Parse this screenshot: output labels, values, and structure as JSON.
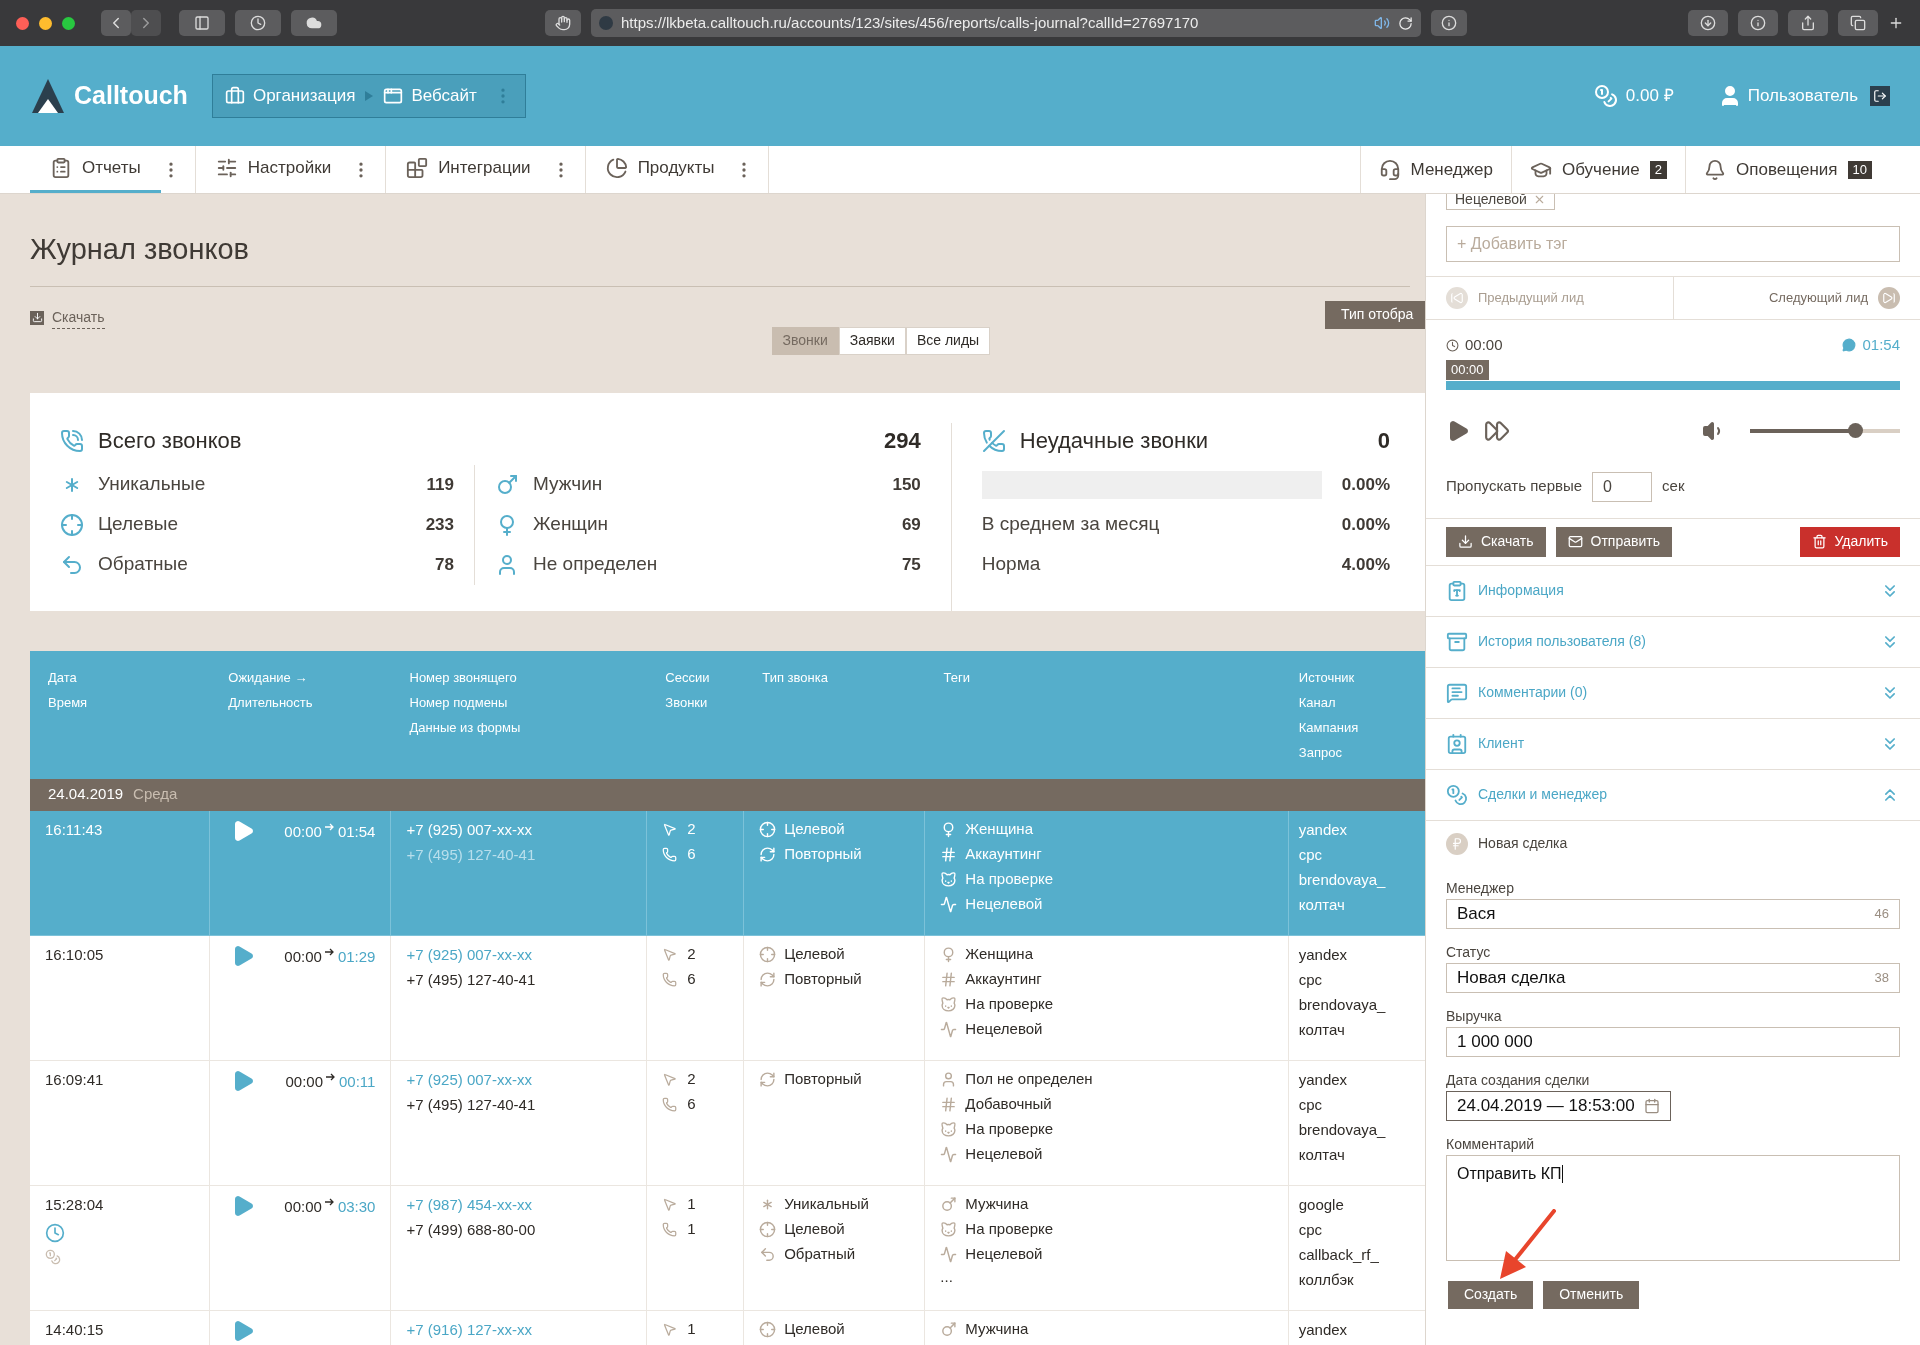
{
  "browser": {
    "url": "https://lkbeta.calltouch.ru/accounts/123/sites/456/reports/calls-journal?callId=27697170"
  },
  "header": {
    "logo": "Calltouch",
    "breadcrumbs": [
      "Организация",
      "Вебсайт"
    ],
    "balance": "0.00 ₽",
    "user": "Пользователь"
  },
  "nav": {
    "left": [
      {
        "kind": "reports",
        "label": "Отчеты",
        "selected": true
      },
      {
        "kind": "settings",
        "label": "Настройки",
        "selected": false
      },
      {
        "kind": "integrations",
        "label": "Интеграции",
        "selected": false
      },
      {
        "kind": "products",
        "label": "Продукты",
        "selected": false
      }
    ],
    "right": [
      {
        "kind": "manager",
        "label": "Менеджер"
      },
      {
        "kind": "learning",
        "label": "Обучение",
        "badge": "2"
      },
      {
        "kind": "alerts",
        "label": "Оповещения",
        "badge": "10"
      }
    ]
  },
  "page": {
    "title": "Журнал звонков",
    "download": "Скачать",
    "display_type": "Тип отобра",
    "tabs": [
      {
        "label": "Звонки",
        "selected": true
      },
      {
        "label": "Заявки",
        "selected": false
      },
      {
        "label": "Все лиды",
        "selected": false
      }
    ]
  },
  "stats": {
    "total": {
      "label": "Всего звонков",
      "value": "294"
    },
    "types": [
      {
        "kind": "unique",
        "label": "Уникальные",
        "value": "119"
      },
      {
        "kind": "target",
        "label": "Целевые",
        "value": "233"
      },
      {
        "kind": "callback",
        "label": "Обратные",
        "value": "78"
      }
    ],
    "genders": [
      {
        "kind": "male",
        "label": "Мужчин",
        "value": "150"
      },
      {
        "kind": "female",
        "label": "Женщин",
        "value": "69"
      },
      {
        "kind": "unknown",
        "label": "Не определен",
        "value": "75"
      }
    ],
    "failed": {
      "label": "Неудачные звонки",
      "value": "0",
      "level": 0,
      "percent": "0.00%",
      "rows": [
        {
          "label": "В среднем за месяц",
          "value": "0.00%"
        },
        {
          "label": "Норма",
          "value": "4.00%"
        }
      ]
    }
  },
  "table": {
    "columns": [
      [
        "Дата",
        "Время"
      ],
      [
        "Ожидание →",
        "Длительность"
      ],
      [
        "Номер звонящего",
        "Номер подмены",
        "Данные из формы"
      ],
      [
        "Сессии",
        "Звонки"
      ],
      [
        "Тип звонка"
      ],
      [
        "Теги"
      ],
      [
        "Источник",
        "Канал",
        "Кампания",
        "Запрос"
      ]
    ],
    "group": {
      "date": "24.04.2019",
      "weekday": "Среда"
    },
    "rows": [
      {
        "selected": true,
        "time": "16:11:43",
        "extra_icons": false,
        "wait": "00:00",
        "duration": "01:54",
        "caller": "+7 (925) 007-xx-xx",
        "substitute": "+7 (495) 127-40-41",
        "sessions": "2",
        "calls": "6",
        "types": [
          {
            "kind": "target",
            "label": "Целевой"
          },
          {
            "kind": "repeat",
            "label": "Повторный"
          }
        ],
        "tags": [
          {
            "kind": "female",
            "label": "Женщина"
          },
          {
            "kind": "hash",
            "label": "Аккаунтинг"
          },
          {
            "kind": "review",
            "label": "На проверке"
          },
          {
            "kind": "nontarget",
            "label": "Нецелевой"
          }
        ],
        "source": [
          "yandex",
          "cpc",
          "brendovaya_",
          "колтач"
        ]
      },
      {
        "selected": false,
        "time": "16:10:05",
        "extra_icons": false,
        "wait": "00:00",
        "duration": "01:29",
        "caller": "+7 (925) 007-xx-xx",
        "substitute": "+7 (495) 127-40-41",
        "sessions": "2",
        "calls": "6",
        "types": [
          {
            "kind": "target",
            "label": "Целевой"
          },
          {
            "kind": "repeat",
            "label": "Повторный"
          }
        ],
        "tags": [
          {
            "kind": "female",
            "label": "Женщина"
          },
          {
            "kind": "hash",
            "label": "Аккаунтинг"
          },
          {
            "kind": "review",
            "label": "На проверке"
          },
          {
            "kind": "nontarget",
            "label": "Нецелевой"
          }
        ],
        "source": [
          "yandex",
          "cpc",
          "brendovaya_",
          "колтач"
        ]
      },
      {
        "selected": false,
        "time": "16:09:41",
        "extra_icons": false,
        "wait": "00:00",
        "duration": "00:11",
        "caller": "+7 (925) 007-xx-xx",
        "substitute": "+7 (495) 127-40-41",
        "sessions": "2",
        "calls": "6",
        "types": [
          {
            "kind": "repeat",
            "label": "Повторный"
          }
        ],
        "tags": [
          {
            "kind": "unknown",
            "label": "Пол не определен"
          },
          {
            "kind": "hash",
            "label": "Добавочный"
          },
          {
            "kind": "review",
            "label": "На проверке"
          },
          {
            "kind": "nontarget",
            "label": "Нецелевой"
          }
        ],
        "source": [
          "yandex",
          "cpc",
          "brendovaya_",
          "колтач"
        ]
      },
      {
        "selected": false,
        "time": "15:28:04",
        "extra_icons": true,
        "wait": "00:00",
        "duration": "03:30",
        "caller": "+7 (987) 454-xx-xx",
        "substitute": "+7 (499) 688-80-00",
        "sessions": "1",
        "calls": "1",
        "types": [
          {
            "kind": "unique",
            "label": "Уникальный"
          },
          {
            "kind": "target",
            "label": "Целевой"
          },
          {
            "kind": "callback",
            "label": "Обратный"
          }
        ],
        "tags": [
          {
            "kind": "male",
            "label": "Мужчина"
          },
          {
            "kind": "review",
            "label": "На проверке"
          },
          {
            "kind": "nontarget",
            "label": "Нецелевой"
          }
        ],
        "more": "...",
        "source": [
          "google",
          "cpc",
          "callback_rf_",
          "коллбэк"
        ]
      },
      {
        "selected": false,
        "time": "14:40:15",
        "extra_icons": false,
        "caller": "+7 (916) 127-xx-xx",
        "sessions": "1",
        "types": [
          {
            "kind": "target",
            "label": "Целевой"
          }
        ],
        "tags": [
          {
            "kind": "male",
            "label": "Мужчина"
          }
        ],
        "source": [
          "yandex"
        ]
      }
    ]
  },
  "panel": {
    "tags": [
      {
        "label": "Нецелевой"
      }
    ],
    "add_tag": {
      "placeholder": "+ Добавить тэг"
    },
    "prev": "Предыдущий лид",
    "next": "Следующий лид",
    "player": {
      "start": "00:00",
      "end": "01:54",
      "position": "00:00",
      "progress": {
        "level": 1
      },
      "volume": {
        "level": 0.7
      }
    },
    "skip": {
      "label": "Пропускать первые",
      "value": "0",
      "unit": "сек"
    },
    "actions": [
      {
        "kind": "download",
        "label": "Скачать"
      },
      {
        "kind": "send",
        "label": "Отправить"
      },
      {
        "kind": "delete",
        "label": "Удалить"
      }
    ],
    "sections": [
      {
        "kind": "info",
        "label": "Информация",
        "expanded": false
      },
      {
        "kind": "history",
        "label": "История пользователя (8)",
        "expanded": false
      },
      {
        "kind": "comments",
        "label": "Комментарии (0)",
        "expanded": false
      },
      {
        "kind": "client",
        "label": "Клиент",
        "expanded": false
      },
      {
        "kind": "deals",
        "label": "Сделки и менеджер",
        "expanded": true
      }
    ],
    "deal": {
      "title": "Новая сделка",
      "fields": [
        {
          "kind": "select",
          "label": "Менеджер",
          "value": "Вася",
          "count": "46"
        },
        {
          "kind": "select",
          "label": "Статус",
          "value": "Новая сделка",
          "count": "38"
        },
        {
          "kind": "text",
          "label": "Выручка",
          "value": "1 000 000"
        },
        {
          "kind": "date",
          "label": "Дата создания сделки",
          "value": "24.04.2019 — 18:53:00"
        },
        {
          "kind": "textarea",
          "label": "Комментарий",
          "value": "Отправить КП"
        }
      ],
      "buttons": [
        "Создать",
        "Отменить"
      ]
    }
  }
}
